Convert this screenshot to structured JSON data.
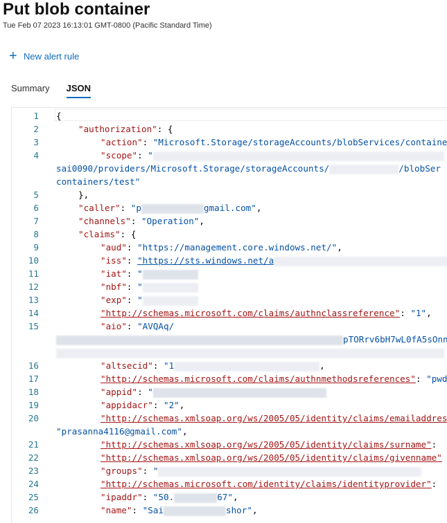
{
  "page": {
    "title": "Put blob container",
    "subtitle": "Tue Feb 07 2023 16:13:01 GMT-0800 (Pacific Standard Time)"
  },
  "toolbar": {
    "new_alert_label": "New alert rule"
  },
  "tabs": [
    {
      "label": "Summary",
      "active": false
    },
    {
      "label": "JSON",
      "active": true
    }
  ],
  "editor": {
    "line_numbers": [
      "1",
      "2",
      "3",
      "4",
      "5",
      "6",
      "7",
      "8",
      "9",
      "10",
      "11",
      "12",
      "13",
      "14",
      "15",
      "16",
      "17",
      "18",
      "19",
      "20",
      "21",
      "22",
      "23",
      "24",
      "25",
      "26"
    ],
    "text": {
      "l1": "{",
      "l2k": "\"authorization\"",
      "l2p": ": {",
      "l3k": "\"action\"",
      "l3v": "\"Microsoft.Storage/storageAccounts/blobServices/containe",
      "l4k": "\"scope\"",
      "l4v": "\"",
      "l4b": "sai0090/providers/Microsoft.Storage/storageAccounts/",
      "l4b2": "/blobSer",
      "l4c": "containers/test\"",
      "l5": "},",
      "l6k": "\"caller\"",
      "l6v1": "\"p",
      "l6v2": "gmail.com\"",
      "l7k": "\"channels\"",
      "l7v": "\"Operation\"",
      "l8k": "\"claims\"",
      "l8p": ": {",
      "l9k": "\"aud\"",
      "l9v": "\"https://management.core.windows.net/\"",
      "l10k": "\"iss\"",
      "l10v": "\"https://sts.windows.net/a",
      "l11k": "\"iat\"",
      "l11v": "\"",
      "l12k": "\"nbf\"",
      "l12v": "\"",
      "l13k": "\"exp\"",
      "l13v": "\"",
      "l14k": "\"http://schemas.microsoft.com/claims/authnclassreference\"",
      "l14v": "\"1\"",
      "l15k": "\"aio\"",
      "l15v": "\"AVQAq/",
      "l15c": "pTORrv6bH7wL0fA5sOnn",
      "l16k": "\"altsecid\"",
      "l16v": "\"1",
      "l17k": "\"http://schemas.microsoft.com/claims/authnmethodsreferences\"",
      "l17v": "\"pwd",
      "l18k": "\"appid\"",
      "l18v": "\"",
      "l19k": "\"appidacr\"",
      "l19v": "\"2\"",
      "l20k": "\"http://schemas.xmlsoap.org/ws/2005/05/identity/claims/emailaddres",
      "l20c": "\"prasanna4116@gmail.com\"",
      "l21k": "\"http://schemas.xmlsoap.org/ws/2005/05/identity/claims/surname\"",
      "l22k": "\"http://schemas.xmlsoap.org/ws/2005/05/identity/claims/givenname\"",
      "l23k": "\"groups\"",
      "l23v": "\"",
      "l24k": "\"http://schemas.microsoft.com/identity/claims/identityprovider\"",
      "l25k": "\"ipaddr\"",
      "l25v1": "\"50.",
      "l25v2": "67\"",
      "l26k": "\"name\"",
      "l26v1": "\"Sai",
      "l26v2": "shor\""
    }
  },
  "colors": {
    "accent": "#0f6cbd",
    "key": "#a31515",
    "string": "#0451a5",
    "line_number": "#237893"
  }
}
